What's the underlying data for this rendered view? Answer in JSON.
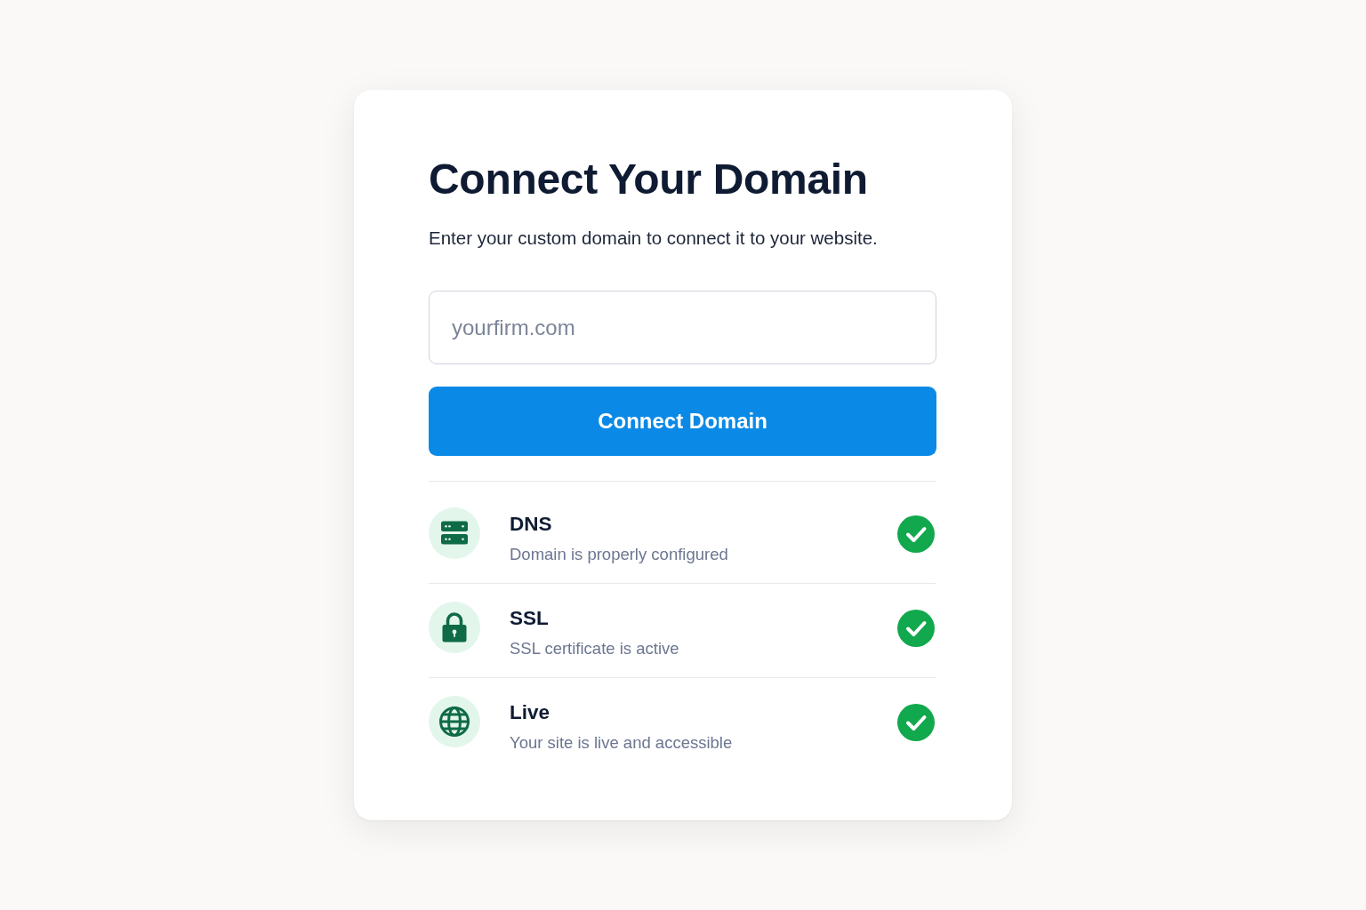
{
  "title": "Connect Your Domain",
  "subtitle": "Enter your custom domain to connect it to your website.",
  "domain_field": {
    "placeholder": "yourfirm.com"
  },
  "connect_button": "Connect Domain",
  "checks": [
    {
      "kind": "dns",
      "name": "DNS",
      "description": "Domain is properly configured",
      "verified": true
    },
    {
      "kind": "ssl",
      "name": "SSL",
      "description": "SSL certificate is active",
      "verified": true
    },
    {
      "kind": "live",
      "name": "Live",
      "description": "Your site is live and accessible",
      "verified": true
    }
  ]
}
